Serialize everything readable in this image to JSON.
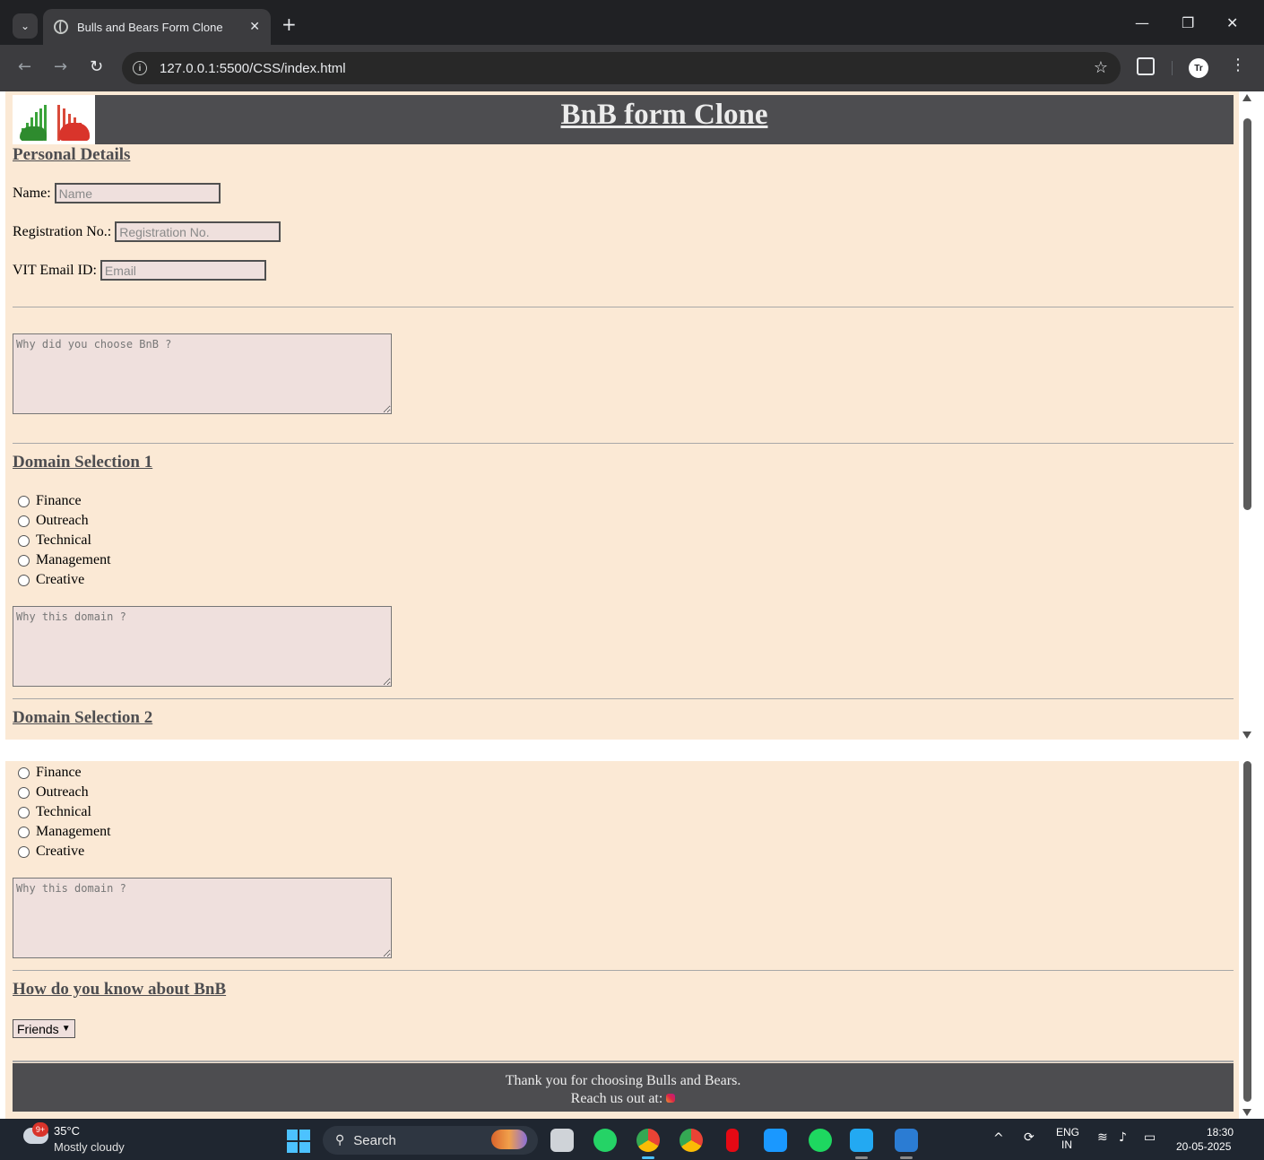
{
  "browser": {
    "tab_title": "Bulls and Bears Form Clone",
    "url": "127.0.0.1:5500/CSS/index.html",
    "profile_initials": "Tr"
  },
  "page": {
    "site_title": "BnB form Clone",
    "personal_details_heading": "Personal Details",
    "fields": [
      {
        "label": "Name:",
        "placeholder": "Name"
      },
      {
        "label": "Registration No.:",
        "placeholder": "Registration No."
      },
      {
        "label": "VIT Email ID:",
        "placeholder": "Email"
      }
    ],
    "why_bnb_placeholder": "Why did you choose BnB ?",
    "domain1": {
      "heading": "Domain Selection 1",
      "options": [
        "Finance",
        "Outreach",
        "Technical",
        "Management",
        "Creative"
      ],
      "textarea_placeholder": "Why this domain ?"
    },
    "domain2": {
      "heading": "Domain Selection 2",
      "options": [
        "Finance",
        "Outreach",
        "Technical",
        "Management",
        "Creative"
      ],
      "textarea_placeholder": "Why this domain ?"
    },
    "know_heading": "How do you know about BnB",
    "know_select_value": "Friends",
    "footer_line1": "Thank you for choosing Bulls and Bears.",
    "footer_line2": "Reach us out at:"
  },
  "taskbar": {
    "weather_badge": "9+",
    "temperature": "35°C",
    "weather": "Mostly cloudy",
    "search_label": "Search",
    "lang_top": "ENG",
    "lang_bottom": "IN",
    "time": "18:30",
    "date": "20-05-2025"
  },
  "colors": {
    "page_background": "#fbe9d5",
    "header_background": "#4d4d50",
    "input_background": "#efe0dd"
  }
}
